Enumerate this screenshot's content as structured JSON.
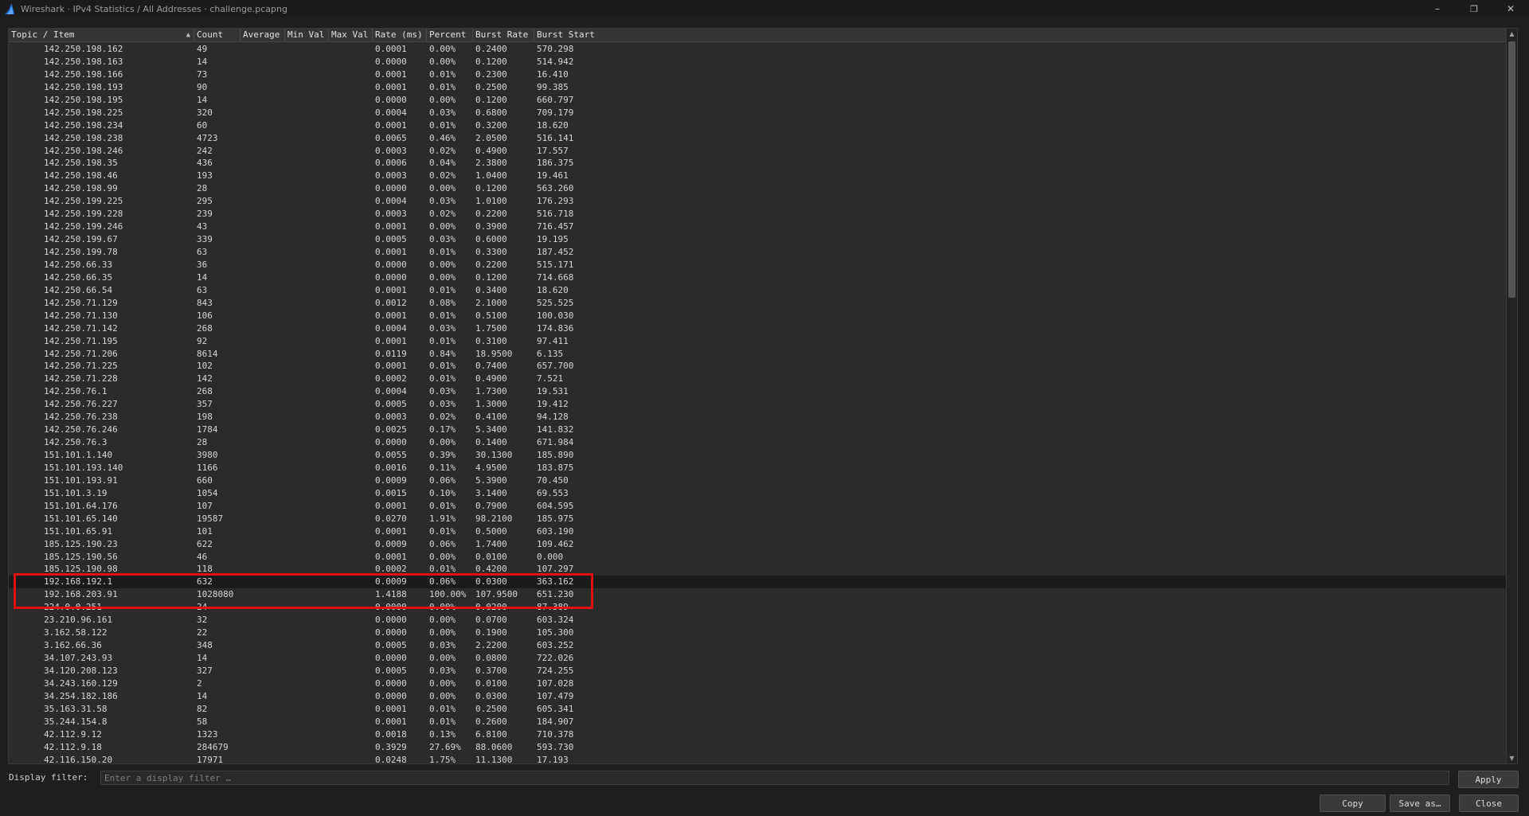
{
  "window": {
    "title": "Wireshark · IPv4 Statistics / All Addresses · challenge.pcapng",
    "controls": {
      "minimize": "–",
      "restore": "❐",
      "close": "✕"
    }
  },
  "table": {
    "columns": [
      "Topic / Item",
      "Count",
      "Average",
      "Min Val",
      "Max Val",
      "Rate (ms)",
      "Percent",
      "Burst Rate",
      "Burst Start"
    ],
    "sort_indicator": "▲",
    "selected_row_index": 42,
    "rows": [
      [
        "142.250.198.162",
        "49",
        "",
        "",
        "",
        "0.0001",
        "0.00%",
        "0.2400",
        "570.298"
      ],
      [
        "142.250.198.163",
        "14",
        "",
        "",
        "",
        "0.0000",
        "0.00%",
        "0.1200",
        "514.942"
      ],
      [
        "142.250.198.166",
        "73",
        "",
        "",
        "",
        "0.0001",
        "0.01%",
        "0.2300",
        "16.410"
      ],
      [
        "142.250.198.193",
        "90",
        "",
        "",
        "",
        "0.0001",
        "0.01%",
        "0.2500",
        "99.385"
      ],
      [
        "142.250.198.195",
        "14",
        "",
        "",
        "",
        "0.0000",
        "0.00%",
        "0.1200",
        "660.797"
      ],
      [
        "142.250.198.225",
        "320",
        "",
        "",
        "",
        "0.0004",
        "0.03%",
        "0.6800",
        "709.179"
      ],
      [
        "142.250.198.234",
        "60",
        "",
        "",
        "",
        "0.0001",
        "0.01%",
        "0.3200",
        "18.620"
      ],
      [
        "142.250.198.238",
        "4723",
        "",
        "",
        "",
        "0.0065",
        "0.46%",
        "2.0500",
        "516.141"
      ],
      [
        "142.250.198.246",
        "242",
        "",
        "",
        "",
        "0.0003",
        "0.02%",
        "0.4900",
        "17.557"
      ],
      [
        "142.250.198.35",
        "436",
        "",
        "",
        "",
        "0.0006",
        "0.04%",
        "2.3800",
        "186.375"
      ],
      [
        "142.250.198.46",
        "193",
        "",
        "",
        "",
        "0.0003",
        "0.02%",
        "1.0400",
        "19.461"
      ],
      [
        "142.250.198.99",
        "28",
        "",
        "",
        "",
        "0.0000",
        "0.00%",
        "0.1200",
        "563.260"
      ],
      [
        "142.250.199.225",
        "295",
        "",
        "",
        "",
        "0.0004",
        "0.03%",
        "1.0100",
        "176.293"
      ],
      [
        "142.250.199.228",
        "239",
        "",
        "",
        "",
        "0.0003",
        "0.02%",
        "0.2200",
        "516.718"
      ],
      [
        "142.250.199.246",
        "43",
        "",
        "",
        "",
        "0.0001",
        "0.00%",
        "0.3900",
        "716.457"
      ],
      [
        "142.250.199.67",
        "339",
        "",
        "",
        "",
        "0.0005",
        "0.03%",
        "0.6000",
        "19.195"
      ],
      [
        "142.250.199.78",
        "63",
        "",
        "",
        "",
        "0.0001",
        "0.01%",
        "0.3300",
        "187.452"
      ],
      [
        "142.250.66.33",
        "36",
        "",
        "",
        "",
        "0.0000",
        "0.00%",
        "0.2200",
        "515.171"
      ],
      [
        "142.250.66.35",
        "14",
        "",
        "",
        "",
        "0.0000",
        "0.00%",
        "0.1200",
        "714.668"
      ],
      [
        "142.250.66.54",
        "63",
        "",
        "",
        "",
        "0.0001",
        "0.01%",
        "0.3400",
        "18.620"
      ],
      [
        "142.250.71.129",
        "843",
        "",
        "",
        "",
        "0.0012",
        "0.08%",
        "2.1000",
        "525.525"
      ],
      [
        "142.250.71.130",
        "106",
        "",
        "",
        "",
        "0.0001",
        "0.01%",
        "0.5100",
        "100.030"
      ],
      [
        "142.250.71.142",
        "268",
        "",
        "",
        "",
        "0.0004",
        "0.03%",
        "1.7500",
        "174.836"
      ],
      [
        "142.250.71.195",
        "92",
        "",
        "",
        "",
        "0.0001",
        "0.01%",
        "0.3100",
        "97.411"
      ],
      [
        "142.250.71.206",
        "8614",
        "",
        "",
        "",
        "0.0119",
        "0.84%",
        "18.9500",
        "6.135"
      ],
      [
        "142.250.71.225",
        "102",
        "",
        "",
        "",
        "0.0001",
        "0.01%",
        "0.7400",
        "657.700"
      ],
      [
        "142.250.71.228",
        "142",
        "",
        "",
        "",
        "0.0002",
        "0.01%",
        "0.4900",
        "7.521"
      ],
      [
        "142.250.76.1",
        "268",
        "",
        "",
        "",
        "0.0004",
        "0.03%",
        "1.7300",
        "19.531"
      ],
      [
        "142.250.76.227",
        "357",
        "",
        "",
        "",
        "0.0005",
        "0.03%",
        "1.3000",
        "19.412"
      ],
      [
        "142.250.76.238",
        "198",
        "",
        "",
        "",
        "0.0003",
        "0.02%",
        "0.4100",
        "94.128"
      ],
      [
        "142.250.76.246",
        "1784",
        "",
        "",
        "",
        "0.0025",
        "0.17%",
        "5.3400",
        "141.832"
      ],
      [
        "142.250.76.3",
        "28",
        "",
        "",
        "",
        "0.0000",
        "0.00%",
        "0.1400",
        "671.984"
      ],
      [
        "151.101.1.140",
        "3980",
        "",
        "",
        "",
        "0.0055",
        "0.39%",
        "30.1300",
        "185.890"
      ],
      [
        "151.101.193.140",
        "1166",
        "",
        "",
        "",
        "0.0016",
        "0.11%",
        "4.9500",
        "183.875"
      ],
      [
        "151.101.193.91",
        "660",
        "",
        "",
        "",
        "0.0009",
        "0.06%",
        "5.3900",
        "70.450"
      ],
      [
        "151.101.3.19",
        "1054",
        "",
        "",
        "",
        "0.0015",
        "0.10%",
        "3.1400",
        "69.553"
      ],
      [
        "151.101.64.176",
        "107",
        "",
        "",
        "",
        "0.0001",
        "0.01%",
        "0.7900",
        "604.595"
      ],
      [
        "151.101.65.140",
        "19587",
        "",
        "",
        "",
        "0.0270",
        "1.91%",
        "98.2100",
        "185.975"
      ],
      [
        "151.101.65.91",
        "101",
        "",
        "",
        "",
        "0.0001",
        "0.01%",
        "0.5000",
        "603.190"
      ],
      [
        "185.125.190.23",
        "622",
        "",
        "",
        "",
        "0.0009",
        "0.06%",
        "1.7400",
        "109.462"
      ],
      [
        "185.125.190.56",
        "46",
        "",
        "",
        "",
        "0.0001",
        "0.00%",
        "0.0100",
        "0.000"
      ],
      [
        "185.125.190.98",
        "118",
        "",
        "",
        "",
        "0.0002",
        "0.01%",
        "0.4200",
        "107.297"
      ],
      [
        "192.168.192.1",
        "632",
        "",
        "",
        "",
        "0.0009",
        "0.06%",
        "0.0300",
        "363.162"
      ],
      [
        "192.168.203.91",
        "1028080",
        "",
        "",
        "",
        "1.4188",
        "100.00%",
        "107.9500",
        "651.230"
      ],
      [
        "224.0.0.251",
        "24",
        "",
        "",
        "",
        "0.0000",
        "0.00%",
        "0.0200",
        "87.389"
      ],
      [
        "23.210.96.161",
        "32",
        "",
        "",
        "",
        "0.0000",
        "0.00%",
        "0.0700",
        "603.324"
      ],
      [
        "3.162.58.122",
        "22",
        "",
        "",
        "",
        "0.0000",
        "0.00%",
        "0.1900",
        "105.300"
      ],
      [
        "3.162.66.36",
        "348",
        "",
        "",
        "",
        "0.0005",
        "0.03%",
        "2.2200",
        "603.252"
      ],
      [
        "34.107.243.93",
        "14",
        "",
        "",
        "",
        "0.0000",
        "0.00%",
        "0.0800",
        "722.026"
      ],
      [
        "34.120.208.123",
        "327",
        "",
        "",
        "",
        "0.0005",
        "0.03%",
        "0.3700",
        "724.255"
      ],
      [
        "34.243.160.129",
        "2",
        "",
        "",
        "",
        "0.0000",
        "0.00%",
        "0.0100",
        "107.028"
      ],
      [
        "34.254.182.186",
        "14",
        "",
        "",
        "",
        "0.0000",
        "0.00%",
        "0.0300",
        "107.479"
      ],
      [
        "35.163.31.58",
        "82",
        "",
        "",
        "",
        "0.0001",
        "0.01%",
        "0.2500",
        "605.341"
      ],
      [
        "35.244.154.8",
        "58",
        "",
        "",
        "",
        "0.0001",
        "0.01%",
        "0.2600",
        "184.907"
      ],
      [
        "42.112.9.12",
        "1323",
        "",
        "",
        "",
        "0.0018",
        "0.13%",
        "6.8100",
        "710.378"
      ],
      [
        "42.112.9.18",
        "284679",
        "",
        "",
        "",
        "0.3929",
        "27.69%",
        "88.0600",
        "593.730"
      ],
      [
        "42.116.150.20",
        "17971",
        "",
        "",
        "",
        "0.0248",
        "1.75%",
        "11.1300",
        "17.193"
      ]
    ]
  },
  "filter": {
    "label": "Display filter:",
    "value": "",
    "placeholder": "Enter a display filter …",
    "apply_label": "Apply"
  },
  "buttons": {
    "copy": "Copy",
    "save_as": "Save as…",
    "close": "Close"
  },
  "colors": {
    "highlight_box": "#e01010",
    "selected_row": "#1b1b1b"
  }
}
